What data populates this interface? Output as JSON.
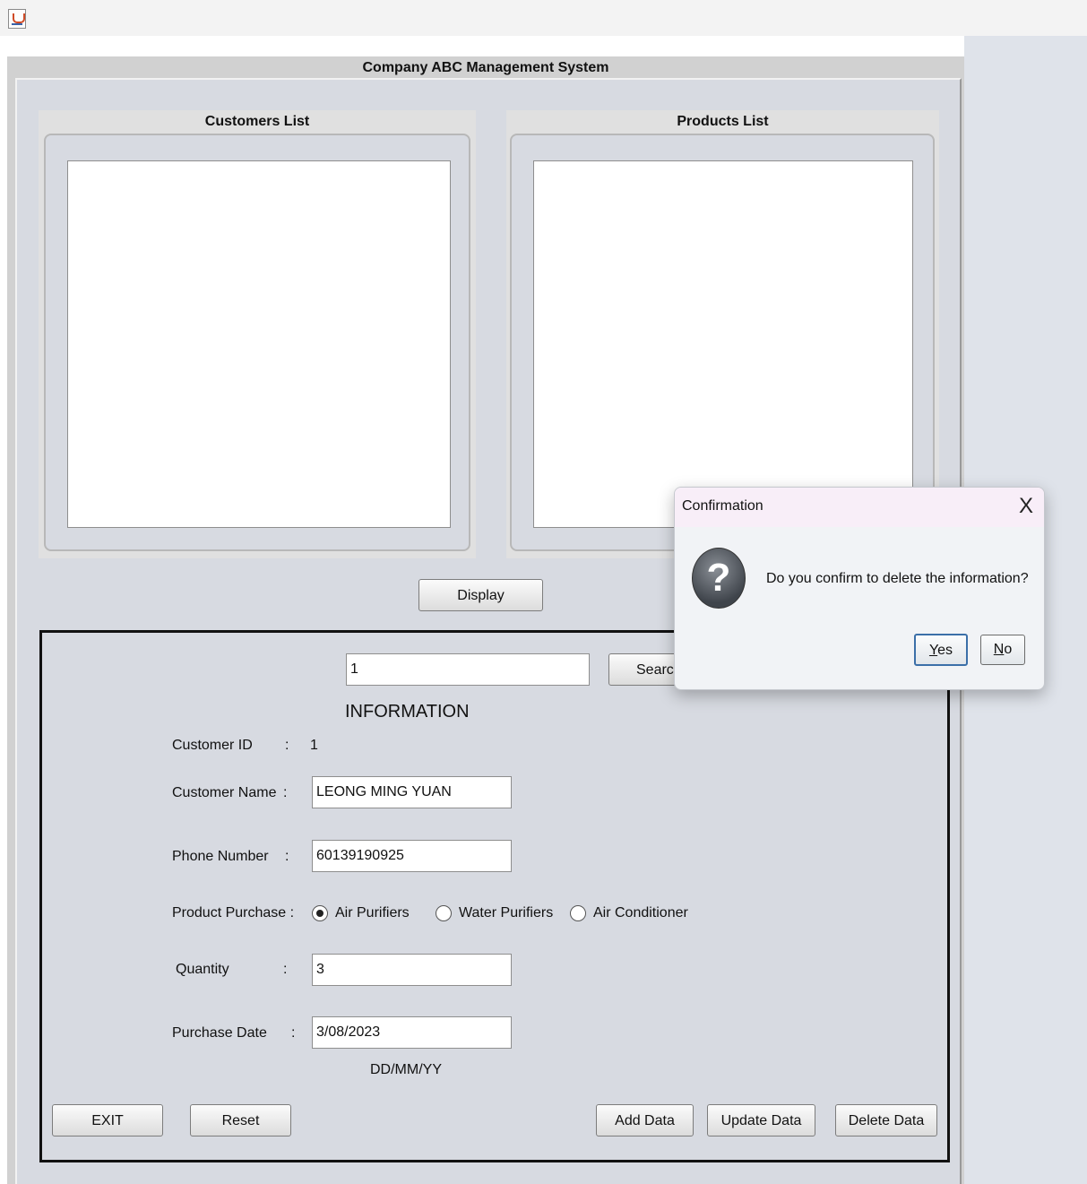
{
  "window": {
    "title": "Company ABC Management System"
  },
  "lists": {
    "customers_title": "Customers List",
    "products_title": "Products List"
  },
  "buttons": {
    "display": "Display",
    "search": "Search",
    "exit": "EXIT",
    "reset": "Reset",
    "add": "Add Data",
    "update": "Update Data",
    "delete": "Delete Data"
  },
  "search": {
    "value": "1"
  },
  "info": {
    "heading": "INFORMATION",
    "customer_id_label": "Customer ID",
    "customer_id_value": "1",
    "customer_name_label": "Customer Name",
    "customer_name_value": "LEONG MING YUAN",
    "phone_label": "Phone Number",
    "phone_value": "60139190925",
    "product_label": "Product Purchase :",
    "product_options": [
      "Air Purifiers",
      "Water Purifiers",
      "Air Conditioner"
    ],
    "product_selected": "Air Purifiers",
    "quantity_label": "Quantity",
    "quantity_value": "3",
    "date_label": "Purchase Date",
    "date_value": "3/08/2023",
    "date_format_hint": "DD/MM/YY",
    "colon": ":"
  },
  "dialog": {
    "title": "Confirmation",
    "close": "X",
    "message": "Do you confirm to delete the information?",
    "yes_mnemonic": "Y",
    "yes_rest": "es",
    "no_mnemonic": "N",
    "no_rest": "o",
    "icon": "question-icon",
    "icon_glyph": "?"
  }
}
